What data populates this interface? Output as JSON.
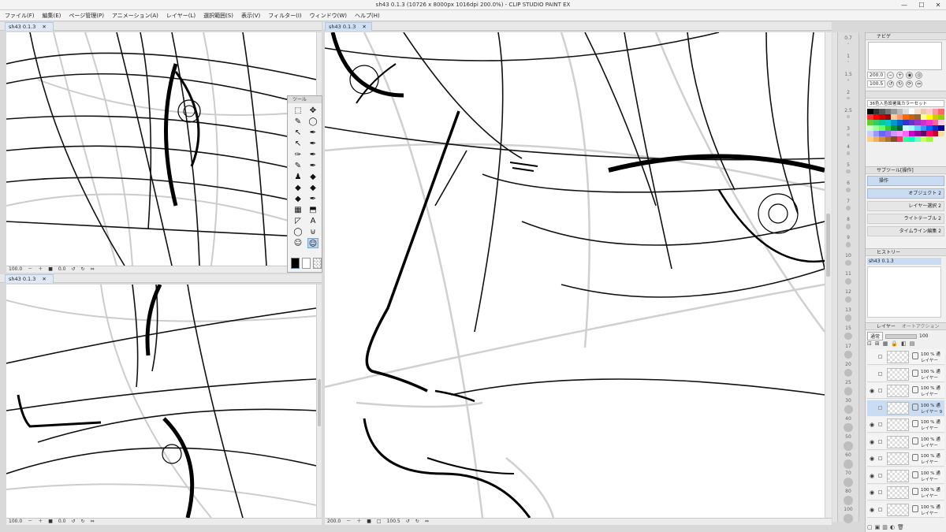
{
  "window": {
    "title": "sh43 0.1.3 (10726 x 8000px 1016dpi 200.0%)  - CLIP STUDIO PAINT EX",
    "minimize": "—",
    "maximize": "☐",
    "close": "✕"
  },
  "menu": [
    "ファイル(F)",
    "編集(E)",
    "ページ管理(P)",
    "アニメーション(A)",
    "レイヤー(L)",
    "選択範囲(S)",
    "表示(V)",
    "フィルター(I)",
    "ウィンドウ(W)",
    "ヘルプ(H)"
  ],
  "canvases": {
    "left_top": {
      "tab": "sh43 0.1.3",
      "zoom": "100.0",
      "rotation": "0.0"
    },
    "left_bottom": {
      "tab": "sh43 0.1.3",
      "zoom": "100.0",
      "rotation": "0.0"
    },
    "main": {
      "tab": "sh43 0.1.3",
      "zoom": "200.0",
      "rotation": "0.0",
      "extra": "100.5"
    },
    "close_glyph": "✕"
  },
  "tool_palette": {
    "title": "ツール",
    "tools": [
      "⬚",
      "✥",
      "✎",
      "◯",
      "↖",
      "✒",
      "↖",
      "✒",
      "✑",
      "✒",
      "✎",
      "✒",
      "♟",
      "◆",
      "◆",
      "◆",
      "◆",
      "✒",
      "▦",
      "⬒",
      "◸",
      "A",
      "◯",
      "⊍",
      "☺",
      "☺"
    ]
  },
  "ruler": {
    "labels": [
      "0.7",
      "1",
      "1.5",
      "2",
      "2.5",
      "3",
      "4",
      "5",
      "6",
      "7",
      "8",
      "9",
      "10",
      "11",
      "12",
      "13",
      "15",
      "17",
      "20",
      "25",
      "30",
      "40",
      "50",
      "60",
      "70",
      "80",
      "100"
    ]
  },
  "navigator": {
    "title": "ナビゲ",
    "zoom": "200.0",
    "angle": "100.5"
  },
  "color_set": {
    "title": "36色入色設署風カラーセット",
    "colors": [
      "#000000",
      "#333333",
      "#555555",
      "#777777",
      "#999999",
      "#bbbbbb",
      "#dddddd",
      "#ffffff",
      "#f0e0d0",
      "#e8c8a8",
      "#ffcccc",
      "#ff9999",
      "#ff6666",
      "#ff3333",
      "#ff0000",
      "#cc0000",
      "#990000",
      "#ffcc99",
      "#ff9966",
      "#ff6600",
      "#cc6600",
      "#996633",
      "#ffff99",
      "#ffff00",
      "#cccc00",
      "#99cc00",
      "#66cc33",
      "#33cc66",
      "#00cc99",
      "#00cccc",
      "#0099cc",
      "#0066cc",
      "#3333cc",
      "#6633cc",
      "#9933cc",
      "#cc33cc",
      "#ff33cc",
      "#ff6699",
      "#ffccee",
      "#ccffcc",
      "#99ff99",
      "#66ff66",
      "#33cc33",
      "#009933",
      "#006633",
      "#ccffff",
      "#99ffff",
      "#66ccff",
      "#3399ff",
      "#0066ff",
      "#0033cc",
      "#000099",
      "#ccccff",
      "#9999ff",
      "#6666ff",
      "#9966ff",
      "#cc99ff",
      "#ff99ff",
      "#ff66ff",
      "#cc00cc",
      "#990099",
      "#660066",
      "#ff0066",
      "#cc0033",
      "#ffe0a0",
      "#ffd080",
      "#f0b060",
      "#d09040",
      "#b07030",
      "#805020",
      "#ff3366",
      "#33ff99",
      "#00ffcc",
      "#66ffcc",
      "#ccff66",
      "#99ff33"
    ]
  },
  "sub_tool": {
    "title": "サブツール[操作]",
    "group": "操作",
    "items": [
      "オブジェクト",
      "レイヤー選択",
      "ライトテーブル",
      "タイムライン編集"
    ],
    "count_suffix": "2"
  },
  "history": {
    "title": "ヒストリー",
    "entries": [
      "sh43 0.1.3"
    ]
  },
  "layers": {
    "title": "レイヤー",
    "tab2": "オートアクション",
    "blend": "通常",
    "opacity": "100",
    "rows": [
      {
        "pct": "100 % 通",
        "name": "レイヤー"
      },
      {
        "pct": "100 % 通",
        "name": "レイヤー"
      },
      {
        "pct": "100 % 通",
        "name": "レイヤー"
      },
      {
        "pct": "100 % 通",
        "name": "レイヤー 9"
      },
      {
        "pct": "100 % 通",
        "name": "レイヤー"
      },
      {
        "pct": "100 % 通",
        "name": "レイヤー"
      },
      {
        "pct": "100 % 通",
        "name": "レイヤー"
      },
      {
        "pct": "100 % 通",
        "name": "レイヤー"
      },
      {
        "pct": "100 % 通",
        "name": "レイヤー"
      },
      {
        "pct": "100 % 通",
        "name": "レイヤー"
      }
    ]
  }
}
